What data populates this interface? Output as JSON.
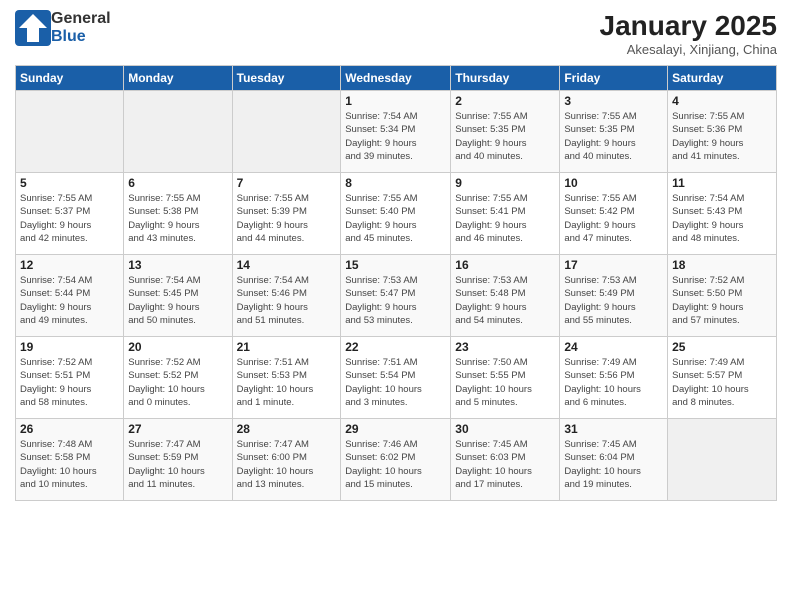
{
  "logo": {
    "general": "General",
    "blue": "Blue"
  },
  "title": "January 2025",
  "subtitle": "Akesalayi, Xinjiang, China",
  "days_of_week": [
    "Sunday",
    "Monday",
    "Tuesday",
    "Wednesday",
    "Thursday",
    "Friday",
    "Saturday"
  ],
  "weeks": [
    [
      {
        "day": "",
        "info": ""
      },
      {
        "day": "",
        "info": ""
      },
      {
        "day": "",
        "info": ""
      },
      {
        "day": "1",
        "info": "Sunrise: 7:54 AM\nSunset: 5:34 PM\nDaylight: 9 hours\nand 39 minutes."
      },
      {
        "day": "2",
        "info": "Sunrise: 7:55 AM\nSunset: 5:35 PM\nDaylight: 9 hours\nand 40 minutes."
      },
      {
        "day": "3",
        "info": "Sunrise: 7:55 AM\nSunset: 5:35 PM\nDaylight: 9 hours\nand 40 minutes."
      },
      {
        "day": "4",
        "info": "Sunrise: 7:55 AM\nSunset: 5:36 PM\nDaylight: 9 hours\nand 41 minutes."
      }
    ],
    [
      {
        "day": "5",
        "info": "Sunrise: 7:55 AM\nSunset: 5:37 PM\nDaylight: 9 hours\nand 42 minutes."
      },
      {
        "day": "6",
        "info": "Sunrise: 7:55 AM\nSunset: 5:38 PM\nDaylight: 9 hours\nand 43 minutes."
      },
      {
        "day": "7",
        "info": "Sunrise: 7:55 AM\nSunset: 5:39 PM\nDaylight: 9 hours\nand 44 minutes."
      },
      {
        "day": "8",
        "info": "Sunrise: 7:55 AM\nSunset: 5:40 PM\nDaylight: 9 hours\nand 45 minutes."
      },
      {
        "day": "9",
        "info": "Sunrise: 7:55 AM\nSunset: 5:41 PM\nDaylight: 9 hours\nand 46 minutes."
      },
      {
        "day": "10",
        "info": "Sunrise: 7:55 AM\nSunset: 5:42 PM\nDaylight: 9 hours\nand 47 minutes."
      },
      {
        "day": "11",
        "info": "Sunrise: 7:54 AM\nSunset: 5:43 PM\nDaylight: 9 hours\nand 48 minutes."
      }
    ],
    [
      {
        "day": "12",
        "info": "Sunrise: 7:54 AM\nSunset: 5:44 PM\nDaylight: 9 hours\nand 49 minutes."
      },
      {
        "day": "13",
        "info": "Sunrise: 7:54 AM\nSunset: 5:45 PM\nDaylight: 9 hours\nand 50 minutes."
      },
      {
        "day": "14",
        "info": "Sunrise: 7:54 AM\nSunset: 5:46 PM\nDaylight: 9 hours\nand 51 minutes."
      },
      {
        "day": "15",
        "info": "Sunrise: 7:53 AM\nSunset: 5:47 PM\nDaylight: 9 hours\nand 53 minutes."
      },
      {
        "day": "16",
        "info": "Sunrise: 7:53 AM\nSunset: 5:48 PM\nDaylight: 9 hours\nand 54 minutes."
      },
      {
        "day": "17",
        "info": "Sunrise: 7:53 AM\nSunset: 5:49 PM\nDaylight: 9 hours\nand 55 minutes."
      },
      {
        "day": "18",
        "info": "Sunrise: 7:52 AM\nSunset: 5:50 PM\nDaylight: 9 hours\nand 57 minutes."
      }
    ],
    [
      {
        "day": "19",
        "info": "Sunrise: 7:52 AM\nSunset: 5:51 PM\nDaylight: 9 hours\nand 58 minutes."
      },
      {
        "day": "20",
        "info": "Sunrise: 7:52 AM\nSunset: 5:52 PM\nDaylight: 10 hours\nand 0 minutes."
      },
      {
        "day": "21",
        "info": "Sunrise: 7:51 AM\nSunset: 5:53 PM\nDaylight: 10 hours\nand 1 minute."
      },
      {
        "day": "22",
        "info": "Sunrise: 7:51 AM\nSunset: 5:54 PM\nDaylight: 10 hours\nand 3 minutes."
      },
      {
        "day": "23",
        "info": "Sunrise: 7:50 AM\nSunset: 5:55 PM\nDaylight: 10 hours\nand 5 minutes."
      },
      {
        "day": "24",
        "info": "Sunrise: 7:49 AM\nSunset: 5:56 PM\nDaylight: 10 hours\nand 6 minutes."
      },
      {
        "day": "25",
        "info": "Sunrise: 7:49 AM\nSunset: 5:57 PM\nDaylight: 10 hours\nand 8 minutes."
      }
    ],
    [
      {
        "day": "26",
        "info": "Sunrise: 7:48 AM\nSunset: 5:58 PM\nDaylight: 10 hours\nand 10 minutes."
      },
      {
        "day": "27",
        "info": "Sunrise: 7:47 AM\nSunset: 5:59 PM\nDaylight: 10 hours\nand 11 minutes."
      },
      {
        "day": "28",
        "info": "Sunrise: 7:47 AM\nSunset: 6:00 PM\nDaylight: 10 hours\nand 13 minutes."
      },
      {
        "day": "29",
        "info": "Sunrise: 7:46 AM\nSunset: 6:02 PM\nDaylight: 10 hours\nand 15 minutes."
      },
      {
        "day": "30",
        "info": "Sunrise: 7:45 AM\nSunset: 6:03 PM\nDaylight: 10 hours\nand 17 minutes."
      },
      {
        "day": "31",
        "info": "Sunrise: 7:45 AM\nSunset: 6:04 PM\nDaylight: 10 hours\nand 19 minutes."
      },
      {
        "day": "",
        "info": ""
      }
    ]
  ]
}
